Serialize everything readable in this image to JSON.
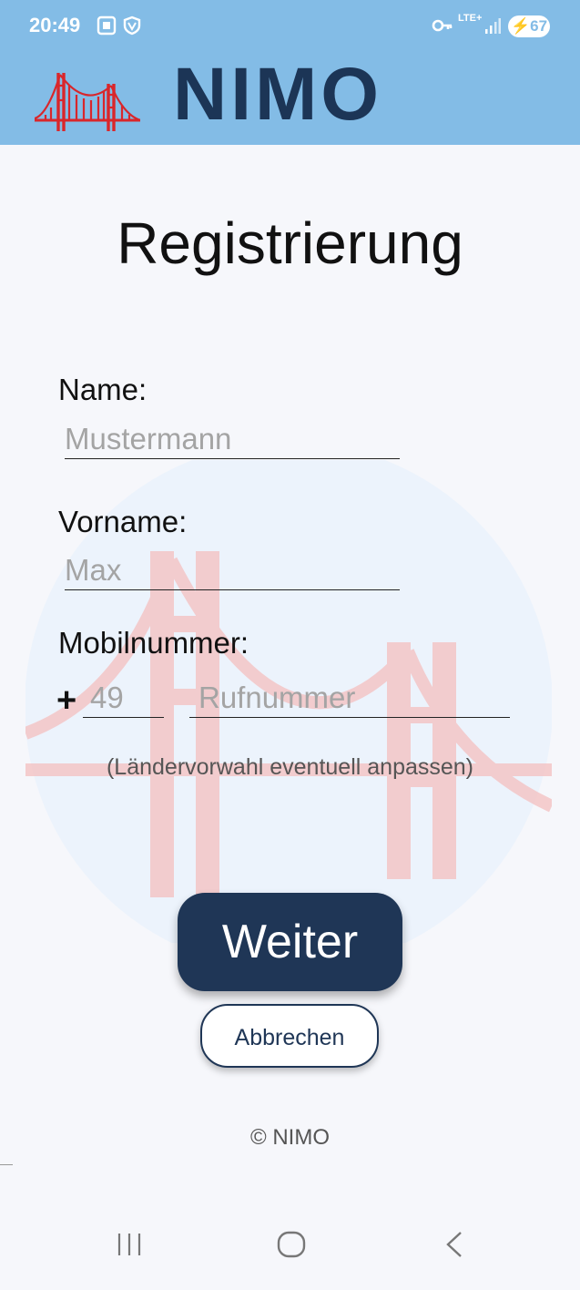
{
  "status_bar": {
    "time": "20:49",
    "network": "LTE+",
    "battery": "67"
  },
  "header": {
    "logo_text": "NIMO"
  },
  "form": {
    "title": "Registrierung",
    "name_label": "Name:",
    "name_placeholder": "Mustermann",
    "firstname_label": "Vorname:",
    "firstname_placeholder": "Max",
    "mobile_label": "Mobilnummer:",
    "country_prefix": "+",
    "country_code_placeholder": "49",
    "phone_placeholder": "Rufnummer",
    "hint": "(Ländervorwahl eventuell anpassen)"
  },
  "actions": {
    "next_label": "Weiter",
    "cancel_label": "Abbrechen"
  },
  "footer": {
    "copyright": "© NIMO"
  },
  "colors": {
    "header_bg": "#83bce6",
    "brand_dark": "#1f3656",
    "bridge_red": "#d9262b"
  },
  "icons": [
    "screenshot-icon",
    "vpn-shield-icon",
    "key-icon",
    "signal-icon",
    "battery-charging-icon",
    "recent-apps-icon",
    "home-icon",
    "back-icon",
    "bridge-logo-icon"
  ]
}
